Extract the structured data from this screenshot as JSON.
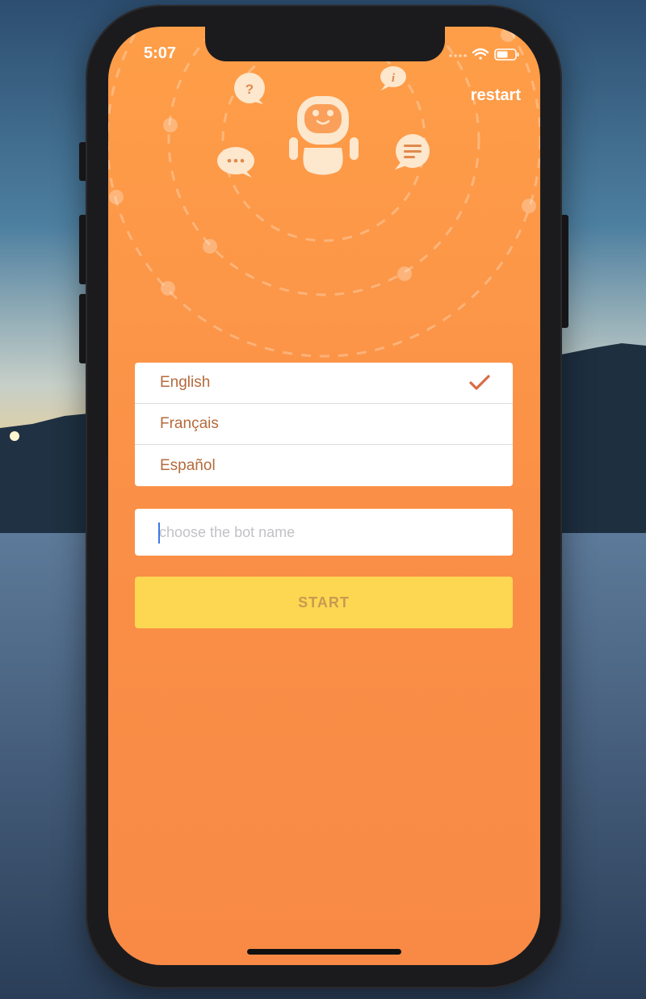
{
  "status_bar": {
    "time": "5:07"
  },
  "header": {
    "restart_label": "restart"
  },
  "languages": {
    "items": [
      {
        "label": "English",
        "selected": true
      },
      {
        "label": "Français",
        "selected": false
      },
      {
        "label": "Español",
        "selected": false
      }
    ]
  },
  "bot_name": {
    "value": "",
    "placeholder": "choose the bot name"
  },
  "start_button": {
    "label": "START"
  },
  "colors": {
    "background_top": "#fe9e48",
    "background_bottom": "#f88a46",
    "text_brown": "#b56a3c",
    "check_color": "#d96c45",
    "start_yellow": "#fdd751",
    "start_text": "#c79a52"
  },
  "icons": [
    "robot-icon",
    "question-bubble-icon",
    "info-bubble-icon",
    "ellipsis-bubble-icon",
    "message-lines-bubble-icon",
    "checkmark-icon",
    "wifi-icon",
    "battery-icon",
    "signal-icon"
  ]
}
